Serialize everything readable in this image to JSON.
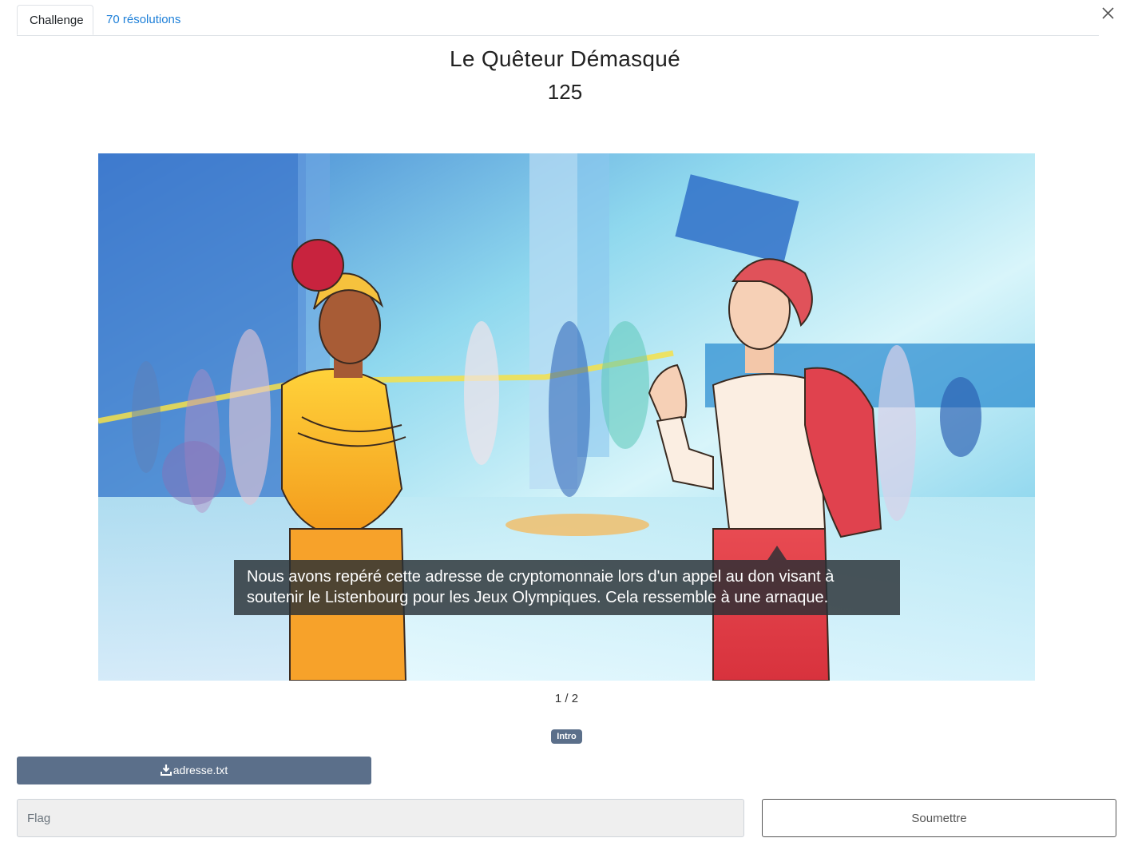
{
  "tabs": {
    "challenge_label": "Challenge",
    "solves_label": "70 résolutions"
  },
  "challenge": {
    "title": "Le Quêteur Démasqué",
    "points": "125"
  },
  "slideshow": {
    "caption": "Nous avons repéré cette adresse de cryptomonnaie lors d'un appel au don visant à soutenir le Listenbourg pour les Jeux Olympiques. Cela ressemble à une arnaque.",
    "pager": "1 / 2",
    "tag": "Intro"
  },
  "files": {
    "download_label": "adresse.txt"
  },
  "flag_form": {
    "placeholder": "Flag",
    "value": "",
    "submit_label": "Soumettre"
  },
  "icons": {
    "close": "close-icon",
    "download": "download-icon"
  },
  "colors": {
    "tab_link": "#1d7fd8",
    "accent_button": "#5b6f8a",
    "caption_bg": "#283034"
  }
}
